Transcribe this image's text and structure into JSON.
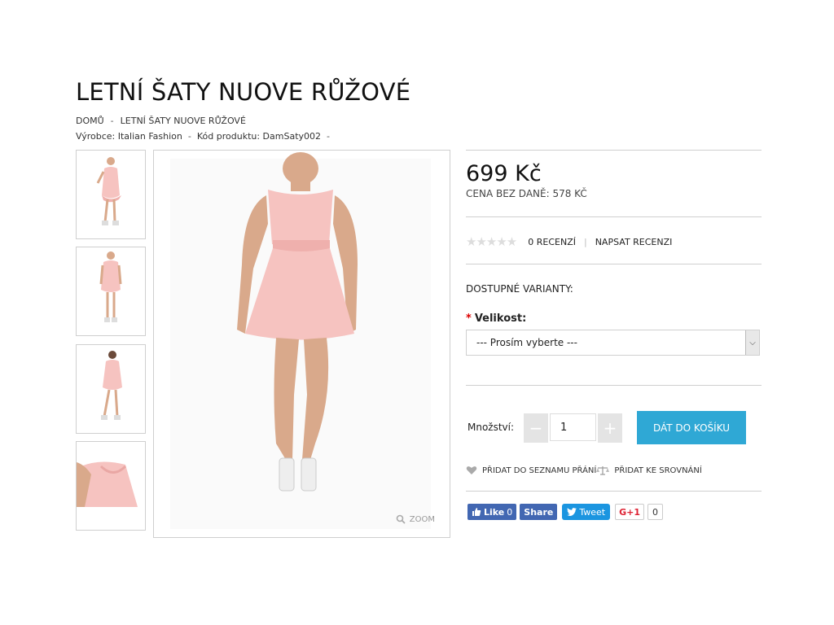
{
  "product": {
    "title": "LETNÍ ŠATY NUOVE RŮŽOVÉ",
    "breadcrumb": [
      "DOMŮ",
      "LETNÍ ŠATY NUOVE RŮŽOVÉ"
    ],
    "manufacturer": "Výrobce: Italian Fashion",
    "code": "Kód produktu: DamSaty002",
    "price": "699 Kč",
    "price_no_tax": "CENA BEZ DANĚ: 578 KČ",
    "zoom_label": "ZOOM"
  },
  "reviews": {
    "rating": 0,
    "count_label": "0 RECENZÍ",
    "write_label": "NAPSAT RECENZI"
  },
  "options": {
    "heading": "DOSTUPNÉ VARIANTY:",
    "size_label": "Velikost:",
    "required_mark": "*",
    "size_selected": "--- Prosím vyberte ---"
  },
  "purchase": {
    "quantity_label": "Množství:",
    "quantity_value": "1",
    "minus": "−",
    "plus": "+",
    "add_to_cart": "DÁT DO KOŠÍKU",
    "wishlist": "PŘIDAT DO SEZNAMU PŘÁNÍ",
    "compare": "PŘIDAT KE SROVNÁNÍ"
  },
  "social": {
    "like": "Like",
    "like_count": "0",
    "share": "Share",
    "tweet": "Tweet",
    "gplus": "G+1",
    "gplus_count": "0"
  },
  "colors": {
    "accent": "#2fa8d5",
    "dress": "#f6c3c0"
  }
}
